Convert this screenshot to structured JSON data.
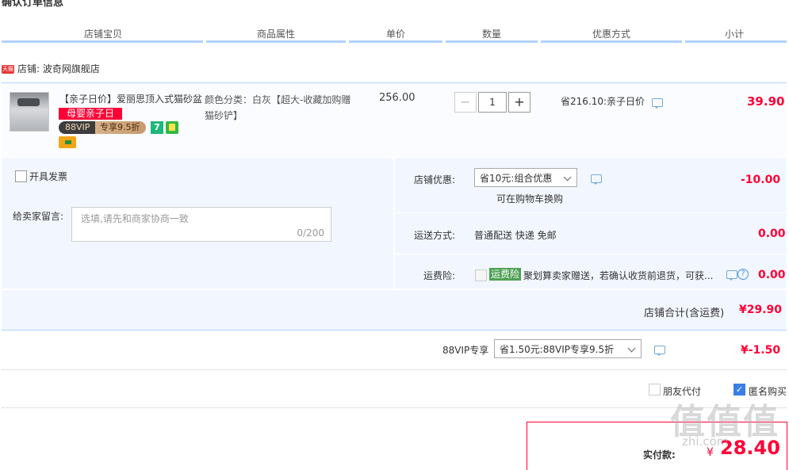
{
  "page_title": "确认订单信息",
  "columns": [
    "店铺宝贝",
    "商品属性",
    "单价",
    "数量",
    "优惠方式",
    "小计"
  ],
  "shop": {
    "badge": "天猫",
    "label": "店铺:",
    "name": "波奇网旗舰店"
  },
  "item": {
    "title": "【亲子日价】爱丽思顶入式猫砂盆",
    "badge_event": "母婴亲子日",
    "badge_vip_left": "88VIP",
    "badge_vip_right": "专享9.5折",
    "badge_seven": "7",
    "attributes": "颜色分类：白灰【超大-收藏加购赠猫砂铲】",
    "unit_price": "256.00",
    "quantity": "1",
    "minus": "−",
    "plus": "+",
    "discount": "省216.10:亲子日价",
    "subtotal": "39.90"
  },
  "invoice": {
    "label": "开具发票"
  },
  "memo": {
    "label": "给卖家留言:",
    "placeholder": "选填,请先和商家协商一致",
    "counter": "0/200"
  },
  "shop_discount": {
    "label": "店铺优惠:",
    "selected": "省10元:组合优惠",
    "note": "可在购物车换购",
    "amount": "-10.00"
  },
  "shipping": {
    "label": "运送方式:",
    "value": "普通配送 快递 免邮",
    "amount": "0.00"
  },
  "insurance": {
    "label": "运费险:",
    "tag": "运费险",
    "text": "聚划算卖家赠送，若确认收货前退货，可获...",
    "help": "?",
    "amount": "0.00"
  },
  "shop_total": {
    "label": "店铺合计(含运费)",
    "amount": "¥29.90"
  },
  "vip": {
    "label": "88VIP专享",
    "selected": "省1.50元:88VIP专享9.5折",
    "amount": "¥-1.50"
  },
  "options": {
    "friend_pay": "朋友代付",
    "anonymous": "匿名购买",
    "anonymous_check": "✓"
  },
  "payment": {
    "label": "实付款:",
    "currency": "¥",
    "amount": "28.40"
  },
  "watermark": {
    "text": "值值值",
    "url": "zhi.com"
  }
}
